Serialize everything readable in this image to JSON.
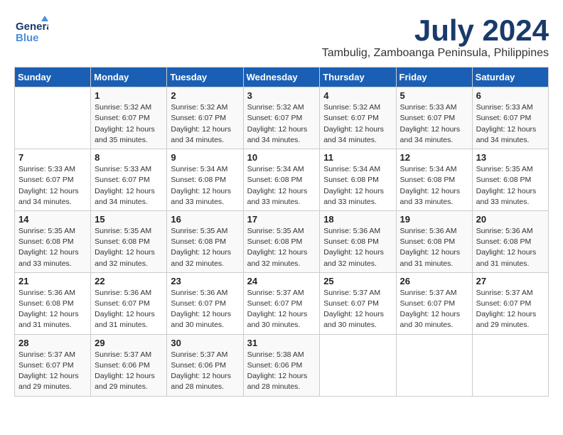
{
  "header": {
    "logo_general": "General",
    "logo_blue": "Blue",
    "month_title": "July 2024",
    "location": "Tambulig, Zamboanga Peninsula, Philippines"
  },
  "weekdays": [
    "Sunday",
    "Monday",
    "Tuesday",
    "Wednesday",
    "Thursday",
    "Friday",
    "Saturday"
  ],
  "weeks": [
    [
      {
        "day": "",
        "info": ""
      },
      {
        "day": "1",
        "info": "Sunrise: 5:32 AM\nSunset: 6:07 PM\nDaylight: 12 hours\nand 35 minutes."
      },
      {
        "day": "2",
        "info": "Sunrise: 5:32 AM\nSunset: 6:07 PM\nDaylight: 12 hours\nand 34 minutes."
      },
      {
        "day": "3",
        "info": "Sunrise: 5:32 AM\nSunset: 6:07 PM\nDaylight: 12 hours\nand 34 minutes."
      },
      {
        "day": "4",
        "info": "Sunrise: 5:32 AM\nSunset: 6:07 PM\nDaylight: 12 hours\nand 34 minutes."
      },
      {
        "day": "5",
        "info": "Sunrise: 5:33 AM\nSunset: 6:07 PM\nDaylight: 12 hours\nand 34 minutes."
      },
      {
        "day": "6",
        "info": "Sunrise: 5:33 AM\nSunset: 6:07 PM\nDaylight: 12 hours\nand 34 minutes."
      }
    ],
    [
      {
        "day": "7",
        "info": "Sunrise: 5:33 AM\nSunset: 6:07 PM\nDaylight: 12 hours\nand 34 minutes."
      },
      {
        "day": "8",
        "info": "Sunrise: 5:33 AM\nSunset: 6:07 PM\nDaylight: 12 hours\nand 34 minutes."
      },
      {
        "day": "9",
        "info": "Sunrise: 5:34 AM\nSunset: 6:08 PM\nDaylight: 12 hours\nand 33 minutes."
      },
      {
        "day": "10",
        "info": "Sunrise: 5:34 AM\nSunset: 6:08 PM\nDaylight: 12 hours\nand 33 minutes."
      },
      {
        "day": "11",
        "info": "Sunrise: 5:34 AM\nSunset: 6:08 PM\nDaylight: 12 hours\nand 33 minutes."
      },
      {
        "day": "12",
        "info": "Sunrise: 5:34 AM\nSunset: 6:08 PM\nDaylight: 12 hours\nand 33 minutes."
      },
      {
        "day": "13",
        "info": "Sunrise: 5:35 AM\nSunset: 6:08 PM\nDaylight: 12 hours\nand 33 minutes."
      }
    ],
    [
      {
        "day": "14",
        "info": "Sunrise: 5:35 AM\nSunset: 6:08 PM\nDaylight: 12 hours\nand 33 minutes."
      },
      {
        "day": "15",
        "info": "Sunrise: 5:35 AM\nSunset: 6:08 PM\nDaylight: 12 hours\nand 32 minutes."
      },
      {
        "day": "16",
        "info": "Sunrise: 5:35 AM\nSunset: 6:08 PM\nDaylight: 12 hours\nand 32 minutes."
      },
      {
        "day": "17",
        "info": "Sunrise: 5:35 AM\nSunset: 6:08 PM\nDaylight: 12 hours\nand 32 minutes."
      },
      {
        "day": "18",
        "info": "Sunrise: 5:36 AM\nSunset: 6:08 PM\nDaylight: 12 hours\nand 32 minutes."
      },
      {
        "day": "19",
        "info": "Sunrise: 5:36 AM\nSunset: 6:08 PM\nDaylight: 12 hours\nand 31 minutes."
      },
      {
        "day": "20",
        "info": "Sunrise: 5:36 AM\nSunset: 6:08 PM\nDaylight: 12 hours\nand 31 minutes."
      }
    ],
    [
      {
        "day": "21",
        "info": "Sunrise: 5:36 AM\nSunset: 6:08 PM\nDaylight: 12 hours\nand 31 minutes."
      },
      {
        "day": "22",
        "info": "Sunrise: 5:36 AM\nSunset: 6:07 PM\nDaylight: 12 hours\nand 31 minutes."
      },
      {
        "day": "23",
        "info": "Sunrise: 5:36 AM\nSunset: 6:07 PM\nDaylight: 12 hours\nand 30 minutes."
      },
      {
        "day": "24",
        "info": "Sunrise: 5:37 AM\nSunset: 6:07 PM\nDaylight: 12 hours\nand 30 minutes."
      },
      {
        "day": "25",
        "info": "Sunrise: 5:37 AM\nSunset: 6:07 PM\nDaylight: 12 hours\nand 30 minutes."
      },
      {
        "day": "26",
        "info": "Sunrise: 5:37 AM\nSunset: 6:07 PM\nDaylight: 12 hours\nand 30 minutes."
      },
      {
        "day": "27",
        "info": "Sunrise: 5:37 AM\nSunset: 6:07 PM\nDaylight: 12 hours\nand 29 minutes."
      }
    ],
    [
      {
        "day": "28",
        "info": "Sunrise: 5:37 AM\nSunset: 6:07 PM\nDaylight: 12 hours\nand 29 minutes."
      },
      {
        "day": "29",
        "info": "Sunrise: 5:37 AM\nSunset: 6:06 PM\nDaylight: 12 hours\nand 29 minutes."
      },
      {
        "day": "30",
        "info": "Sunrise: 5:37 AM\nSunset: 6:06 PM\nDaylight: 12 hours\nand 28 minutes."
      },
      {
        "day": "31",
        "info": "Sunrise: 5:38 AM\nSunset: 6:06 PM\nDaylight: 12 hours\nand 28 minutes."
      },
      {
        "day": "",
        "info": ""
      },
      {
        "day": "",
        "info": ""
      },
      {
        "day": "",
        "info": ""
      }
    ]
  ]
}
